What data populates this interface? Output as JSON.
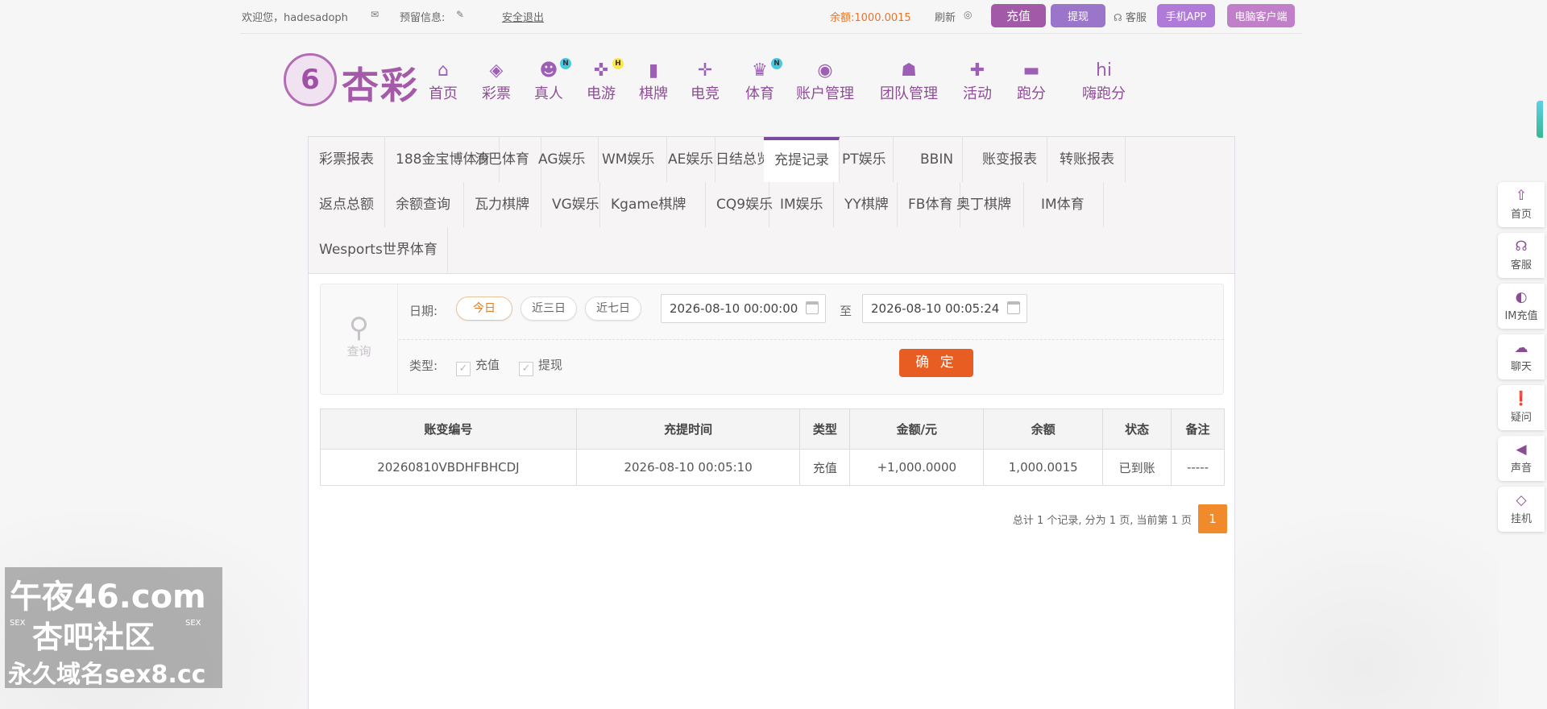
{
  "topbar": {
    "welcome": "欢迎您，hadesadoph",
    "reserved_info_label": "预留信息:",
    "logout": "安全退出",
    "balance_label": "余额:",
    "balance_value": "1000.0015",
    "refresh": "刷新",
    "recharge_btn": "充值",
    "withdraw_btn": "提现",
    "service": "客服",
    "mobile_app_btn": "手机APP",
    "pc_client_btn": "电脑客户端"
  },
  "logo": {
    "glyph": "6",
    "text": "杏彩"
  },
  "nav": [
    {
      "label": "首页",
      "icon": "home-icon",
      "glyph": "⌂"
    },
    {
      "label": "彩票",
      "icon": "ticket-icon",
      "glyph": "◈"
    },
    {
      "label": "真人",
      "icon": "dealer-icon",
      "glyph": "☻",
      "badge": "N"
    },
    {
      "label": "电游",
      "icon": "gamepad-icon",
      "glyph": "✜",
      "badge": "H"
    },
    {
      "label": "棋牌",
      "icon": "cards-icon",
      "glyph": "▮"
    },
    {
      "label": "电竞",
      "icon": "joystick-icon",
      "glyph": "✛"
    },
    {
      "label": "体育",
      "icon": "trophy-icon",
      "glyph": "♛",
      "badge": "N"
    },
    {
      "label": "账户管理",
      "icon": "account-icon",
      "glyph": "◉"
    },
    {
      "label": "团队管理",
      "icon": "team-icon",
      "glyph": "☗"
    },
    {
      "label": "活动",
      "icon": "gift-icon",
      "glyph": "✚"
    },
    {
      "label": "跑分",
      "icon": "car-icon",
      "glyph": "▬"
    },
    {
      "label": "嗨跑分",
      "icon": "hi-icon",
      "glyph": "hi"
    }
  ],
  "tabs_row1": [
    "彩票报表",
    "188金宝博体育",
    "沙巴体育",
    "AG娱乐",
    "WM娱乐",
    "AE娱乐",
    "日结总览",
    "充提记录",
    "PT娱乐",
    "BBIN",
    "账变报表",
    "转账报表"
  ],
  "tabs_row2": [
    "返点总额",
    "余额查询",
    "瓦力棋牌",
    "VG娱乐",
    "Kgame棋牌",
    "CQ9娱乐",
    "IM娱乐",
    "YY棋牌",
    "FB体育",
    "奥丁棋牌",
    "IM体育"
  ],
  "tabs_row3": [
    "Wesports世界体育"
  ],
  "active_tab": "充提记录",
  "query": {
    "side_label": "查询",
    "date_label": "日期:",
    "quick_dates": [
      "今日",
      "近三日",
      "近七日"
    ],
    "start_date": "2026-08-10 00:00:00",
    "to": "至",
    "end_date": "2026-08-10 00:05:24",
    "type_label": "类型:",
    "types": [
      "充值",
      "提现"
    ],
    "confirm": "确 定"
  },
  "table": {
    "headers": [
      "账变编号",
      "充提时间",
      "类型",
      "金额/元",
      "余额",
      "状态",
      "备注"
    ],
    "rows": [
      [
        "20260810VBDHFBHCDJ",
        "2026-08-10 00:05:10",
        "充值",
        "+1,000.0000",
        "1,000.0015",
        "已到账",
        "-----"
      ]
    ]
  },
  "pager": {
    "summary": "总计 1 个记录, 分为 1 页, 当前第 1 页",
    "current": "1"
  },
  "float_menu": [
    {
      "label": "首页",
      "icon": "arrow-up-icon",
      "glyph": "⇧"
    },
    {
      "label": "客服",
      "icon": "headset-icon",
      "glyph": "☊"
    },
    {
      "label": "IM充值",
      "icon": "im-recharge-icon",
      "glyph": "◐"
    },
    {
      "label": "聊天",
      "icon": "chat-icon",
      "glyph": "☁"
    },
    {
      "label": "疑问",
      "icon": "question-icon",
      "glyph": "❗"
    },
    {
      "label": "声音",
      "icon": "speaker-icon",
      "glyph": "◀"
    },
    {
      "label": "挂机",
      "icon": "diamond-icon",
      "glyph": "◇"
    }
  ],
  "watermark": {
    "line1": "午夜46.com",
    "line2": "杏吧社区",
    "line3": "永久域名sex8.cc",
    "sex_tag": "SEX"
  },
  "colors": {
    "accent": "#a259a8",
    "confirm": "#e85e22",
    "amount": "#d9342b",
    "status_ok": "#3b9a37",
    "pager": "#f08a2a"
  }
}
